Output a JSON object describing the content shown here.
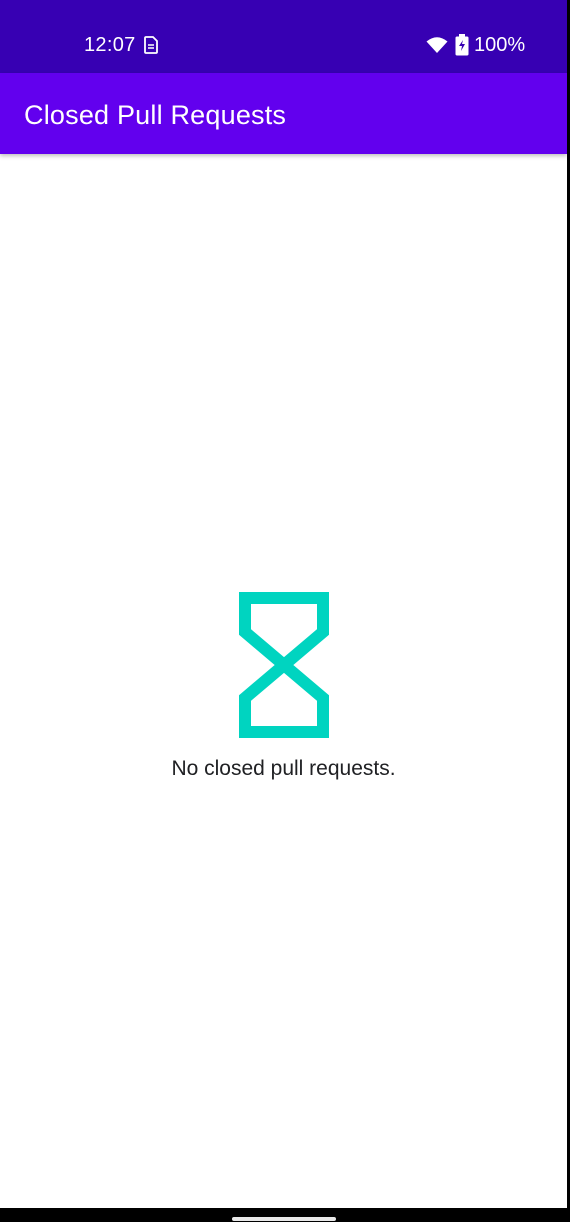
{
  "status_bar": {
    "time": "12:07",
    "battery_percent": "100%",
    "icons": [
      "sim-card-icon",
      "wifi-icon",
      "battery-charging-icon"
    ],
    "background_color": "#3700b3"
  },
  "app_bar": {
    "title": "Closed Pull Requests",
    "background_color": "#6200ee"
  },
  "empty_state": {
    "icon": "hourglass-icon",
    "icon_color": "#00d4c0",
    "message": "No closed pull requests."
  }
}
